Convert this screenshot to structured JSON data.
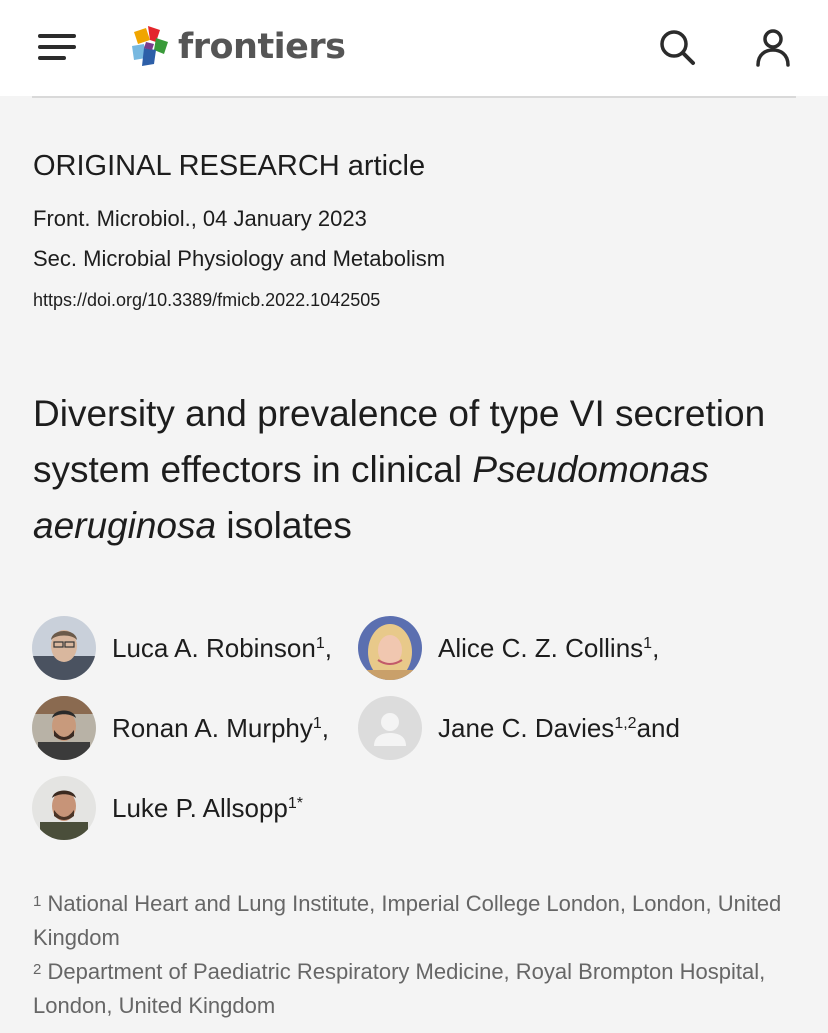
{
  "header": {
    "brand": "frontiers",
    "menu_icon": "hamburger-menu-icon",
    "search_icon": "search-icon",
    "account_icon": "user-icon",
    "brand_colors": [
      "#f0a500",
      "#e3262c",
      "#3a9a3a",
      "#2d5fa8",
      "#77b8e0"
    ]
  },
  "article": {
    "type": "ORIGINAL RESEARCH article",
    "journal_date": "Front. Microbiol., 04 January 2023",
    "section": "Sec. Microbial Physiology and Metabolism",
    "doi": "https://doi.org/10.3389/fmicb.2022.1042505",
    "title_part1": "Diversity and prevalence of type VI secretion system effectors in clinical ",
    "title_italic": "Pseudomonas aeruginosa",
    "title_part2": " isolates"
  },
  "authors": [
    {
      "name": "Luca A. Robinson",
      "sup": "1",
      "suffix": ","
    },
    {
      "name": "Alice C. Z. Collins",
      "sup": "1",
      "suffix": ","
    },
    {
      "name": "Ronan A. Murphy",
      "sup": "1",
      "suffix": ","
    },
    {
      "name": "Jane C. Davies",
      "sup": "1,2",
      "suffix": " and"
    },
    {
      "name": "Luke P. Allsopp",
      "sup": "1*",
      "suffix": ""
    }
  ],
  "affiliations": [
    {
      "num": "1",
      "text": "National Heart and Lung Institute, Imperial College London, London, United Kingdom"
    },
    {
      "num": "2",
      "text": "Department of Paediatric Respiratory Medicine, Royal Brompton Hospital, London, United Kingdom"
    }
  ]
}
